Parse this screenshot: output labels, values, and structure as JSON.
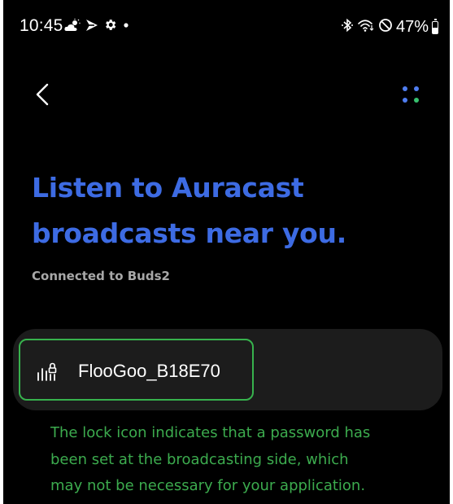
{
  "status_bar": {
    "time": "10:45",
    "battery_text": "47%",
    "battery_level": 0.47,
    "left_icons": [
      "cloud-sun-icon",
      "flag-icon",
      "gear-icon",
      "dot-icon"
    ],
    "right_icons": [
      "bluetooth-icon",
      "wifi-icon",
      "do-not-disturb-icon",
      "battery-icon"
    ]
  },
  "header": {
    "back_icon": "chevron-left-icon",
    "more_icon": "more-options-icon"
  },
  "title_line1": "Listen to Auracast",
  "title_line2": "broadcasts near you.",
  "subtitle": "Connected to Buds2",
  "broadcasts": [
    {
      "name": "FlooGoo_B18E70",
      "icon": "broadcast-locked-icon"
    }
  ],
  "note": {
    "line1": "The lock icon indicates that a password has",
    "line2": "been set at the broadcasting side, which",
    "line3": "may not be necessary for your application."
  },
  "colors": {
    "background": "#000000",
    "title": "#3d6be3",
    "subtitle": "#a8a8a8",
    "card": "#1c1c1c",
    "annotation": "#3cab4e",
    "dot_blue": "#4f7df0",
    "dot_green": "#37c16e"
  }
}
